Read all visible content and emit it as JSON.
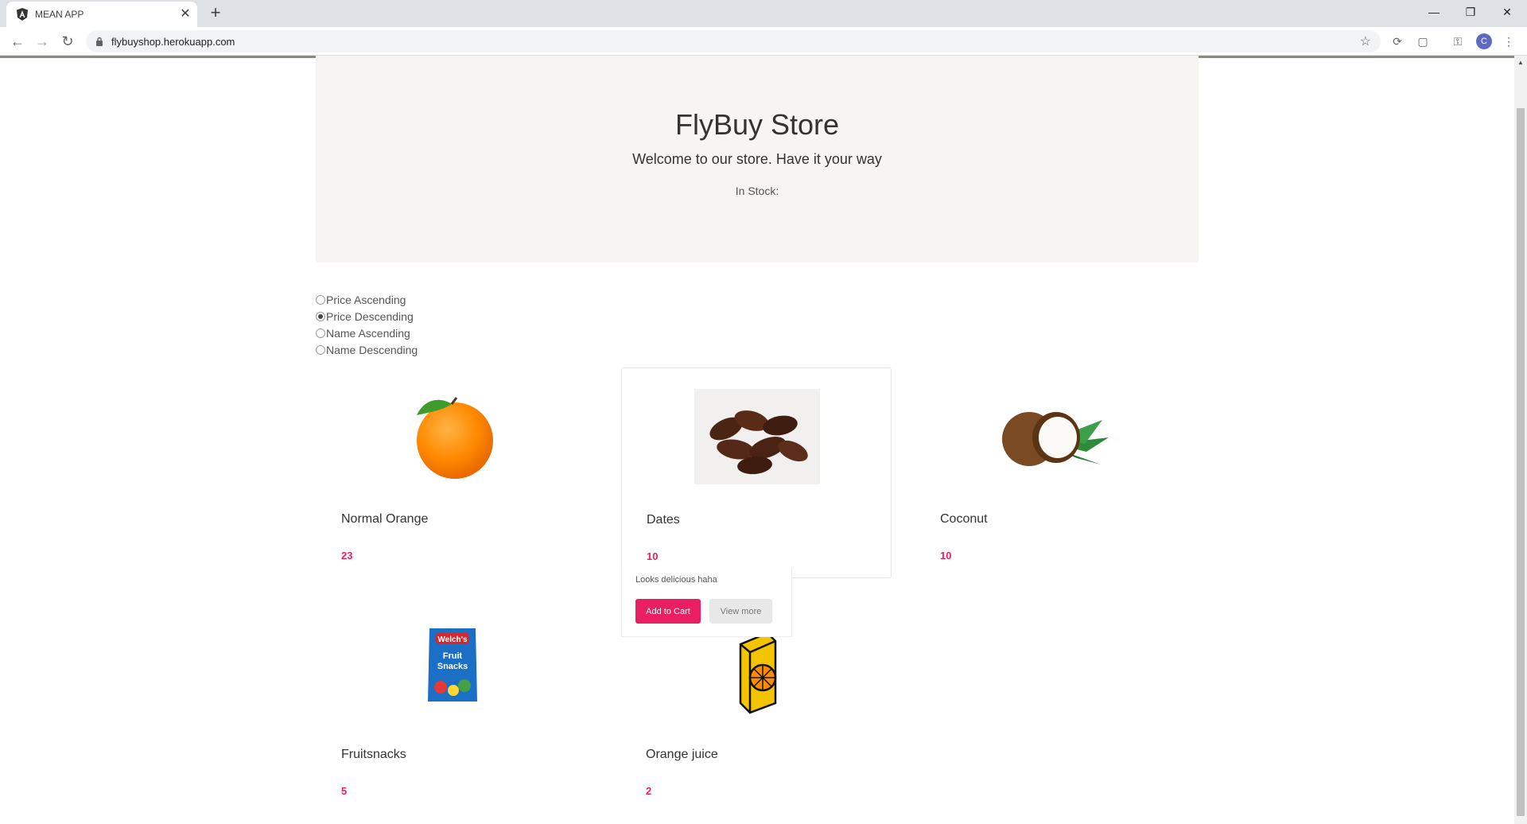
{
  "browser": {
    "tab_title": "MEAN APP",
    "url": "flybuyshop.herokuapp.com",
    "profile_initial": "C"
  },
  "store": {
    "title": "FlyBuy Store",
    "welcome": "Welcome to our store. Have it your way",
    "stock_label": "In Stock:"
  },
  "sort": {
    "options": [
      "Price Ascending",
      "Price Descending",
      "Name Ascending",
      "Name Descending"
    ],
    "selected": "Price Descending"
  },
  "products": [
    {
      "name": "Normal Orange",
      "price": "23",
      "image": "orange"
    },
    {
      "name": "Dates",
      "price": "10",
      "image": "dates"
    },
    {
      "name": "Coconut",
      "price": "10",
      "image": "coconut"
    },
    {
      "name": "Fruitsnacks",
      "price": "5",
      "image": "fruit-snacks-bag"
    },
    {
      "name": "Orange juice",
      "price": "2",
      "image": "juice-box"
    }
  ],
  "popover": {
    "description": "Looks delicious haha",
    "add_to_cart": "Add to Cart",
    "view_more": "View more"
  },
  "colors": {
    "accent": "#e91e63",
    "jumbotron_bg": "#f7f5f1"
  }
}
